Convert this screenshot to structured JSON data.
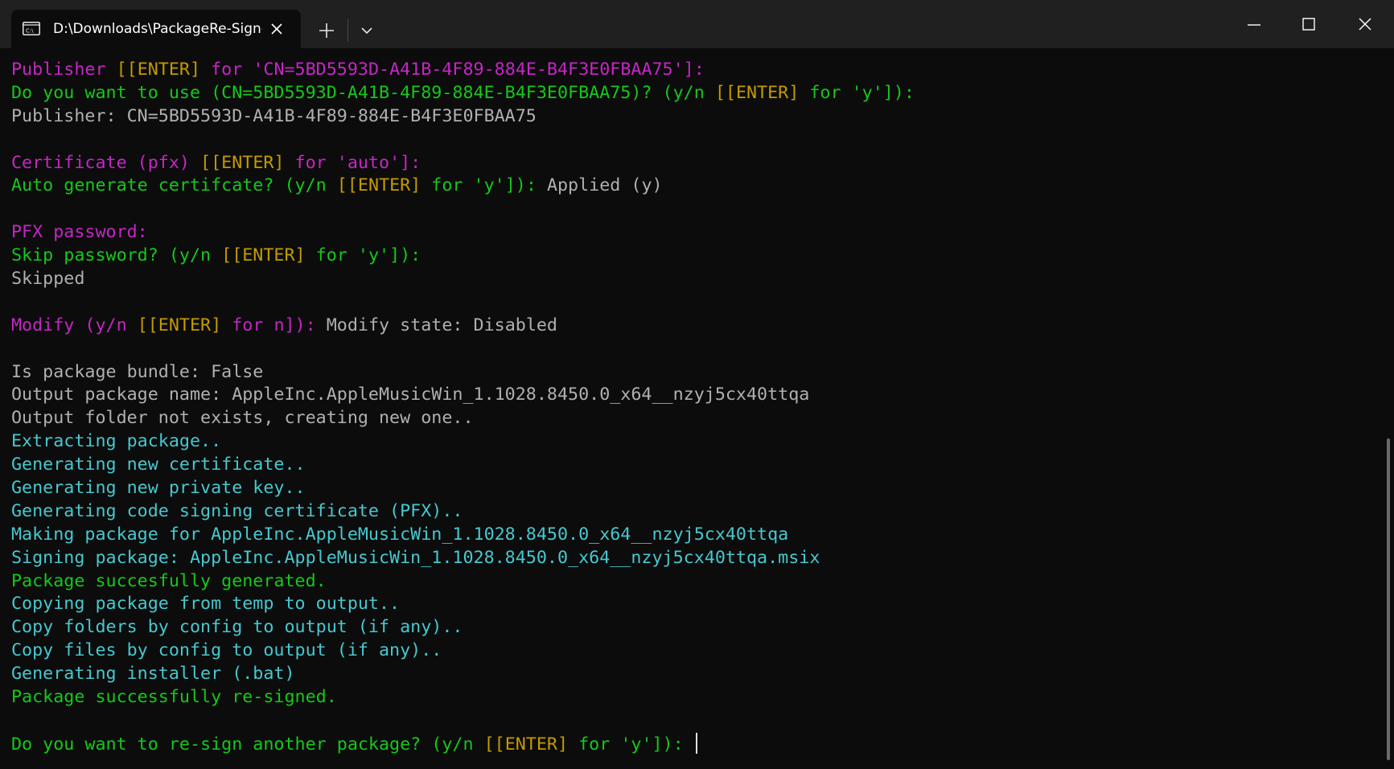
{
  "window": {
    "tab_title": "D:\\Downloads\\PackageRe-Signer",
    "icons": {
      "tab": "terminal-icon",
      "close_tab": "close-icon",
      "new_tab": "plus-icon",
      "dropdown": "chevron-down-icon",
      "minimize": "minimize-icon",
      "maximize": "maximize-icon",
      "close_window": "close-icon"
    }
  },
  "colors": {
    "background": "#0c0c0c",
    "titlebar": "#202020",
    "magenta": "#c526c5",
    "yellow": "#c39a00",
    "green": "#14c81a",
    "gray": "#b0b0b0",
    "cyan": "#46c8cf"
  },
  "terminal": {
    "lines": [
      [
        {
          "t": "Publisher ",
          "c": "magenta"
        },
        {
          "t": "[[ENTER]",
          "c": "yellow"
        },
        {
          "t": " for 'CN=5BD5593D-A41B-4F89-884E-B4F3E0FBAA75']:",
          "c": "magenta"
        }
      ],
      [
        {
          "t": "Do you want to use (CN=5BD5593D-A41B-4F89-884E-B4F3E0FBAA75)? (y/n ",
          "c": "green"
        },
        {
          "t": "[[ENTER]",
          "c": "yellow"
        },
        {
          "t": " for 'y']):",
          "c": "green"
        }
      ],
      [
        {
          "t": "Publisher: CN=5BD5593D-A41B-4F89-884E-B4F3E0FBAA75",
          "c": "gray"
        }
      ],
      [],
      [
        {
          "t": "Certificate (pfx) ",
          "c": "magenta"
        },
        {
          "t": "[[ENTER]",
          "c": "yellow"
        },
        {
          "t": " for 'auto']:",
          "c": "magenta"
        }
      ],
      [
        {
          "t": "Auto generate certifcate? (y/n ",
          "c": "green"
        },
        {
          "t": "[[ENTER]",
          "c": "yellow"
        },
        {
          "t": " for 'y']): ",
          "c": "green"
        },
        {
          "t": "Applied (y)",
          "c": "gray"
        }
      ],
      [],
      [
        {
          "t": "PFX password:",
          "c": "magenta"
        }
      ],
      [
        {
          "t": "Skip password? (y/n ",
          "c": "green"
        },
        {
          "t": "[[ENTER]",
          "c": "yellow"
        },
        {
          "t": " for 'y']):",
          "c": "green"
        }
      ],
      [
        {
          "t": "Skipped",
          "c": "gray"
        }
      ],
      [],
      [
        {
          "t": "Modify (y/n ",
          "c": "magenta"
        },
        {
          "t": "[[ENTER]",
          "c": "yellow"
        },
        {
          "t": " for n]): ",
          "c": "magenta"
        },
        {
          "t": "Modify state: Disabled",
          "c": "gray"
        }
      ],
      [],
      [
        {
          "t": "Is package bundle: False",
          "c": "gray"
        }
      ],
      [
        {
          "t": "Output package name: AppleInc.AppleMusicWin_1.1028.8450.0_x64__nzyj5cx40ttqa",
          "c": "gray"
        }
      ],
      [
        {
          "t": "Output folder not exists, creating new one..",
          "c": "gray"
        }
      ],
      [
        {
          "t": "Extracting package..",
          "c": "cyan"
        }
      ],
      [
        {
          "t": "Generating new certificate..",
          "c": "cyan"
        }
      ],
      [
        {
          "t": "Generating new private key..",
          "c": "cyan"
        }
      ],
      [
        {
          "t": "Generating code signing certificate (PFX)..",
          "c": "cyan"
        }
      ],
      [
        {
          "t": "Making package for AppleInc.AppleMusicWin_1.1028.8450.0_x64__nzyj5cx40ttqa",
          "c": "cyan"
        }
      ],
      [
        {
          "t": "Signing package: AppleInc.AppleMusicWin_1.1028.8450.0_x64__nzyj5cx40ttqa.msix",
          "c": "cyan"
        }
      ],
      [
        {
          "t": "Package succesfully generated.",
          "c": "green"
        }
      ],
      [
        {
          "t": "Copying package from temp to output..",
          "c": "cyan"
        }
      ],
      [
        {
          "t": "Copy folders by config to output (if any)..",
          "c": "cyan"
        }
      ],
      [
        {
          "t": "Copy files by config to output (if any)..",
          "c": "cyan"
        }
      ],
      [
        {
          "t": "Generating installer (.bat)",
          "c": "cyan"
        }
      ],
      [
        {
          "t": "Package successfully re-signed.",
          "c": "green"
        }
      ],
      [],
      [
        {
          "t": "Do you want to re-sign another package? (y/n ",
          "c": "green"
        },
        {
          "t": "[[ENTER]",
          "c": "yellow"
        },
        {
          "t": " for 'y']): ",
          "c": "green"
        }
      ]
    ]
  }
}
